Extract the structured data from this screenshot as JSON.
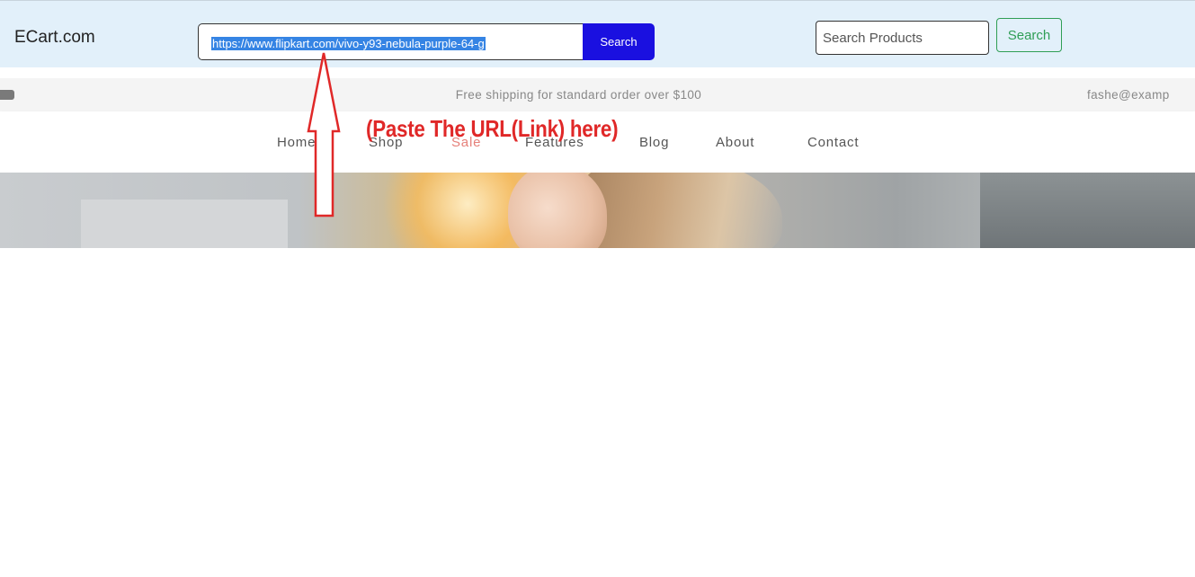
{
  "header": {
    "brand": "ECart.com",
    "url_input": {
      "value": "https://www.flipkart.com/vivo-y93-nebula-purple-64-g",
      "button_label": "Search"
    },
    "product_search": {
      "placeholder": "Search Products",
      "button_label": "Search"
    }
  },
  "promo_bar": {
    "text": "Free shipping for standard order over $100",
    "email": "fashe@examp",
    "icon": "youtube-icon"
  },
  "nav": {
    "items": [
      {
        "label": "Home"
      },
      {
        "label": "Shop"
      },
      {
        "label": "Sale"
      },
      {
        "label": "Features"
      },
      {
        "label": "Blog"
      },
      {
        "label": "About"
      },
      {
        "label": "Contact"
      }
    ]
  },
  "annotation": {
    "text": "(Paste The URL(Link) here)",
    "color": "#e02828"
  },
  "colors": {
    "topbar_bg": "#e2f0fa",
    "url_button": "#1a10e0",
    "search_button": "#2f9e55",
    "sale_nav": "#e6807a"
  }
}
